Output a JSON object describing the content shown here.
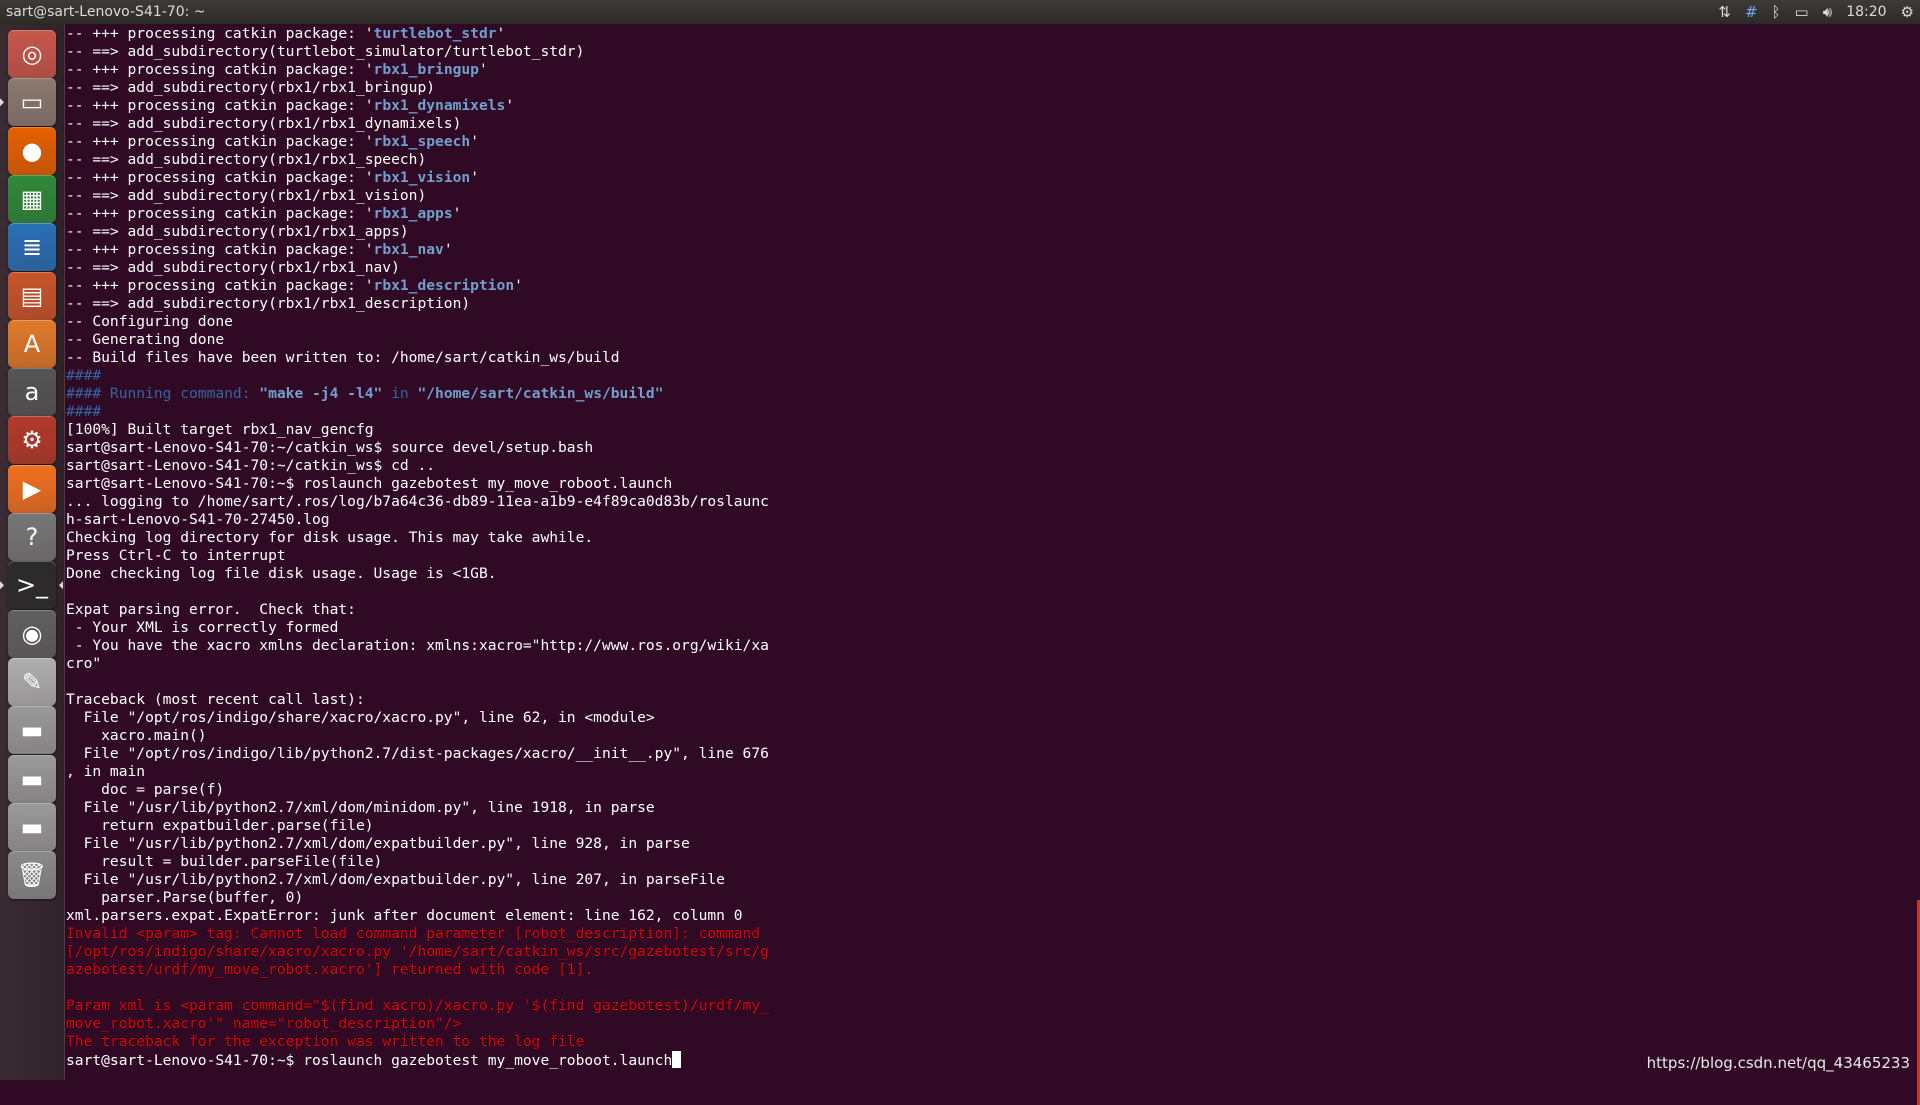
{
  "window": {
    "title": "sart@sart-Lenovo-S41-70: ~"
  },
  "tray": {
    "network_icon": "network-updown-icon",
    "input_icon": "keyboard-layout-icon",
    "bluetooth_icon": "bluetooth-icon",
    "battery_icon": "battery-icon",
    "volume_icon": "volume-icon",
    "clock": "18:20",
    "settings_icon": "gear-icon"
  },
  "launcher": {
    "items": [
      {
        "name": "ubuntu-dash",
        "glyph": "◎",
        "color": "#c9574a"
      },
      {
        "name": "files",
        "glyph": "▭",
        "color": "#8a7a70"
      },
      {
        "name": "firefox",
        "glyph": "●",
        "color": "#e66000"
      },
      {
        "name": "libreoffice-calc",
        "glyph": "▦",
        "color": "#2f8a3a"
      },
      {
        "name": "libreoffice-writer",
        "glyph": "≣",
        "color": "#2a6fb5"
      },
      {
        "name": "libreoffice-impress",
        "glyph": "▤",
        "color": "#c9542a"
      },
      {
        "name": "software-center",
        "glyph": "A",
        "color": "#e07a2a"
      },
      {
        "name": "amazon",
        "glyph": "a",
        "color": "#555555"
      },
      {
        "name": "system-settings",
        "glyph": "⚙",
        "color": "#b33a2a"
      },
      {
        "name": "media-player",
        "glyph": "▶",
        "color": "#f07020"
      },
      {
        "name": "help",
        "glyph": "?",
        "color": "#777777"
      },
      {
        "name": "terminal",
        "glyph": ">_",
        "color": "#2b2b2b"
      },
      {
        "name": "gazebo",
        "glyph": "◉",
        "color": "#606060"
      },
      {
        "name": "text-editor",
        "glyph": "✎",
        "color": "#b0b0b0"
      },
      {
        "name": "drive-1",
        "glyph": "▬",
        "color": "#9a9a9a"
      },
      {
        "name": "drive-2",
        "glyph": "▬",
        "color": "#9a9a9a"
      },
      {
        "name": "drive-3",
        "glyph": "▬",
        "color": "#9a9a9a"
      },
      {
        "name": "trash",
        "glyph": "🗑",
        "color": "#8a8a8a"
      }
    ]
  },
  "terminal": {
    "lines": [
      [
        {
          "t": "-- +++ processing catkin package: '"
        },
        {
          "t": "turtlebot_stdr",
          "c": "hl-blue"
        },
        {
          "t": "'"
        }
      ],
      [
        {
          "t": "-- ==> add_subdirectory(turtlebot_simulator/turtlebot_stdr)"
        }
      ],
      [
        {
          "t": "-- +++ processing catkin package: '"
        },
        {
          "t": "rbx1_bringup",
          "c": "hl-blue"
        },
        {
          "t": "'"
        }
      ],
      [
        {
          "t": "-- ==> add_subdirectory(rbx1/rbx1_bringup)"
        }
      ],
      [
        {
          "t": "-- +++ processing catkin package: '"
        },
        {
          "t": "rbx1_dynamixels",
          "c": "hl-blue"
        },
        {
          "t": "'"
        }
      ],
      [
        {
          "t": "-- ==> add_subdirectory(rbx1/rbx1_dynamixels)"
        }
      ],
      [
        {
          "t": "-- +++ processing catkin package: '"
        },
        {
          "t": "rbx1_speech",
          "c": "hl-blue"
        },
        {
          "t": "'"
        }
      ],
      [
        {
          "t": "-- ==> add_subdirectory(rbx1/rbx1_speech)"
        }
      ],
      [
        {
          "t": "-- +++ processing catkin package: '"
        },
        {
          "t": "rbx1_vision",
          "c": "hl-blue"
        },
        {
          "t": "'"
        }
      ],
      [
        {
          "t": "-- ==> add_subdirectory(rbx1/rbx1_vision)"
        }
      ],
      [
        {
          "t": "-- +++ processing catkin package: '"
        },
        {
          "t": "rbx1_apps",
          "c": "hl-blue"
        },
        {
          "t": "'"
        }
      ],
      [
        {
          "t": "-- ==> add_subdirectory(rbx1/rbx1_apps)"
        }
      ],
      [
        {
          "t": "-- +++ processing catkin package: '"
        },
        {
          "t": "rbx1_nav",
          "c": "hl-blue"
        },
        {
          "t": "'"
        }
      ],
      [
        {
          "t": "-- ==> add_subdirectory(rbx1/rbx1_nav)"
        }
      ],
      [
        {
          "t": "-- +++ processing catkin package: '"
        },
        {
          "t": "rbx1_description",
          "c": "hl-blue"
        },
        {
          "t": "'"
        }
      ],
      [
        {
          "t": "-- ==> add_subdirectory(rbx1/rbx1_description)"
        }
      ],
      [
        {
          "t": "-- Configuring done"
        }
      ],
      [
        {
          "t": "-- Generating done"
        }
      ],
      [
        {
          "t": "-- Build files have been written to: /home/sart/catkin_ws/build"
        }
      ],
      [
        {
          "t": "####",
          "c": "blue"
        }
      ],
      [
        {
          "t": "#### Running command: ",
          "c": "blue"
        },
        {
          "t": "\"make -j4 -l4\"",
          "c": "blue-b"
        },
        {
          "t": " in ",
          "c": "blue"
        },
        {
          "t": "\"/home/sart/catkin_ws/build\"",
          "c": "blue-b"
        }
      ],
      [
        {
          "t": "####",
          "c": "blue"
        }
      ],
      [
        {
          "t": "[100%] Built target rbx1_nav_gencfg"
        }
      ],
      [
        {
          "t": "sart@sart-Lenovo-S41-70:~/catkin_ws$ source devel/setup.bash"
        }
      ],
      [
        {
          "t": "sart@sart-Lenovo-S41-70:~/catkin_ws$ cd .."
        }
      ],
      [
        {
          "t": "sart@sart-Lenovo-S41-70:~$ roslaunch gazebotest my_move_roboot.launch"
        }
      ],
      [
        {
          "t": "... logging to /home/sart/.ros/log/b7a64c36-db89-11ea-a1b9-e4f89ca0d83b/roslaunc"
        }
      ],
      [
        {
          "t": "h-sart-Lenovo-S41-70-27450.log"
        }
      ],
      [
        {
          "t": "Checking log directory for disk usage. This may take awhile."
        }
      ],
      [
        {
          "t": "Press Ctrl-C to interrupt"
        }
      ],
      [
        {
          "t": "Done checking log file disk usage. Usage is <1GB."
        }
      ],
      [
        {
          "t": ""
        }
      ],
      [
        {
          "t": "Expat parsing error.  Check that:"
        }
      ],
      [
        {
          "t": " - Your XML is correctly formed"
        }
      ],
      [
        {
          "t": " - You have the xacro xmlns declaration: xmlns:xacro=\"http://www.ros.org/wiki/xa"
        }
      ],
      [
        {
          "t": "cro\""
        }
      ],
      [
        {
          "t": ""
        }
      ],
      [
        {
          "t": "Traceback (most recent call last):"
        }
      ],
      [
        {
          "t": "  File \"/opt/ros/indigo/share/xacro/xacro.py\", line 62, in <module>"
        }
      ],
      [
        {
          "t": "    xacro.main()"
        }
      ],
      [
        {
          "t": "  File \"/opt/ros/indigo/lib/python2.7/dist-packages/xacro/__init__.py\", line 676"
        }
      ],
      [
        {
          "t": ", in main"
        }
      ],
      [
        {
          "t": "    doc = parse(f)"
        }
      ],
      [
        {
          "t": "  File \"/usr/lib/python2.7/xml/dom/minidom.py\", line 1918, in parse"
        }
      ],
      [
        {
          "t": "    return expatbuilder.parse(file)"
        }
      ],
      [
        {
          "t": "  File \"/usr/lib/python2.7/xml/dom/expatbuilder.py\", line 928, in parse"
        }
      ],
      [
        {
          "t": "    result = builder.parseFile(file)"
        }
      ],
      [
        {
          "t": "  File \"/usr/lib/python2.7/xml/dom/expatbuilder.py\", line 207, in parseFile"
        }
      ],
      [
        {
          "t": "    parser.Parse(buffer, 0)"
        }
      ],
      [
        {
          "t": "xml.parsers.expat.ExpatError: junk after document element: line 162, column 0"
        }
      ],
      [
        {
          "t": "Invalid <param> tag: Cannot load command parameter [robot_description]: command",
          "c": "red"
        }
      ],
      [
        {
          "t": "[/opt/ros/indigo/share/xacro/xacro.py '/home/sart/catkin_ws/src/gazebotest/src/g",
          "c": "red"
        }
      ],
      [
        {
          "t": "azebotest/urdf/my_move_robot.xacro'] returned with code [1].",
          "c": "red"
        }
      ],
      [
        {
          "t": ""
        }
      ],
      [
        {
          "t": "Param xml is <param command=\"$(find xacro)/xacro.py '$(find gazebotest)/urdf/my_",
          "c": "red"
        }
      ],
      [
        {
          "t": "move_robot.xacro'\" name=\"robot_description\"/>",
          "c": "red"
        }
      ],
      [
        {
          "t": "The traceback for the exception was written to the log file",
          "c": "red"
        }
      ]
    ],
    "prompt": "sart@sart-Lenovo-S41-70:~$ roslaunch gazebotest my_move_roboot.launch"
  },
  "watermark": "https://blog.csdn.net/qq_43465233"
}
